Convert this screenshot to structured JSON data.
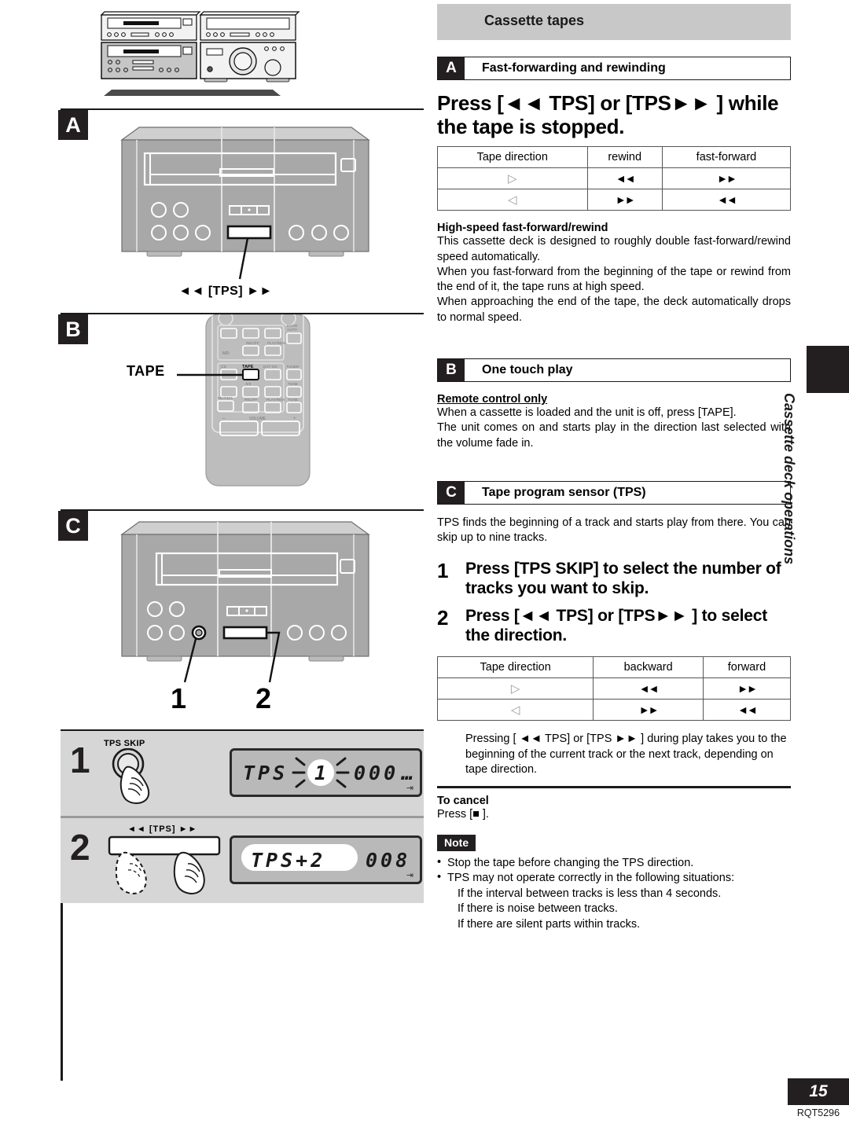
{
  "chapter": {
    "title": "Cassette tapes"
  },
  "side_tab": {
    "label": "Cassette deck operations"
  },
  "footer": {
    "page_number": "15",
    "doc_code": "RQT5296"
  },
  "sections": {
    "a": {
      "tag": "A",
      "title": "Fast-forwarding and rewinding",
      "heading": "Press [◄◄ TPS] or [TPS►► ] while the tape is stopped.",
      "table": {
        "headers": [
          "Tape direction",
          "rewind",
          "fast-forward"
        ],
        "rows": [
          {
            "direction": "▷",
            "col2": "◄◄",
            "col3": "►►"
          },
          {
            "direction": "◁",
            "col2": "►►",
            "col3": "◄◄"
          }
        ]
      },
      "subhead": "High-speed fast-forward/rewind",
      "paragraphs": [
        "This cassette deck is designed to roughly double fast-forward/rewind speed automatically.",
        "When you fast-forward from the beginning of the tape or rewind from the end of it, the tape runs at high speed.",
        "When approaching the end of the tape, the deck automatically drops to normal speed."
      ]
    },
    "b": {
      "tag": "B",
      "title": "One touch play",
      "subhead": "Remote control only",
      "paragraphs": [
        "When a cassette is loaded and the unit is off, press [TAPE].",
        "The unit comes on and starts play in the direction last selected with the volume fade in."
      ]
    },
    "c": {
      "tag": "C",
      "title": "Tape program sensor (TPS)",
      "intro": "TPS finds the beginning of a track and starts play from there. You can skip up to nine tracks.",
      "steps": [
        {
          "number": "1",
          "text": "Press [TPS SKIP] to select the number of tracks you want to skip."
        },
        {
          "number": "2",
          "text": "Press [◄◄ TPS] or [TPS►► ] to select the direction."
        }
      ],
      "table": {
        "headers": [
          "Tape direction",
          "backward",
          "forward"
        ],
        "rows": [
          {
            "direction": "▷",
            "col2": "◄◄",
            "col3": "►►"
          },
          {
            "direction": "◁",
            "col2": "►►",
            "col3": "◄◄"
          }
        ]
      },
      "after_table": "Pressing [ ◄◄ TPS] or [TPS ►► ] during play takes you to the beginning of the current track or the next track, depending on tape direction.",
      "cancel_head": "To cancel",
      "cancel_text": "Press [■ ].",
      "note_badge": "Note",
      "notes": [
        "Stop the tape before changing the TPS direction.",
        "TPS may not operate correctly in the following situations:"
      ],
      "note_subs": [
        "If the interval between tracks is less than 4 seconds.",
        "If there is noise between tracks.",
        "If there are silent parts within tracks."
      ]
    }
  },
  "figures": {
    "panel_a": {
      "tag": "A",
      "callout": "◄◄ [TPS] ►►"
    },
    "panel_b": {
      "tag": "B",
      "callout": "TAPE"
    },
    "panel_c": {
      "tag": "C",
      "callout_1": "1",
      "callout_2": "2"
    },
    "step1": {
      "number": "1",
      "button_label": "TPS SKIP",
      "display_prefix": "TPS",
      "display_blink": "1",
      "display_counter": "000",
      "display_tail": "…"
    },
    "step2": {
      "number": "2",
      "button_label": "◄◄  [TPS]  ►►",
      "display_text": "TPS+2",
      "display_counter": "008"
    }
  },
  "colors": {
    "ink": "#231f20",
    "chapter_bar": "#c8c8c8",
    "step_bg": "#d6d6d6",
    "lcd_bg": "#b9b9b9",
    "chassis": "#a8a8a8"
  }
}
